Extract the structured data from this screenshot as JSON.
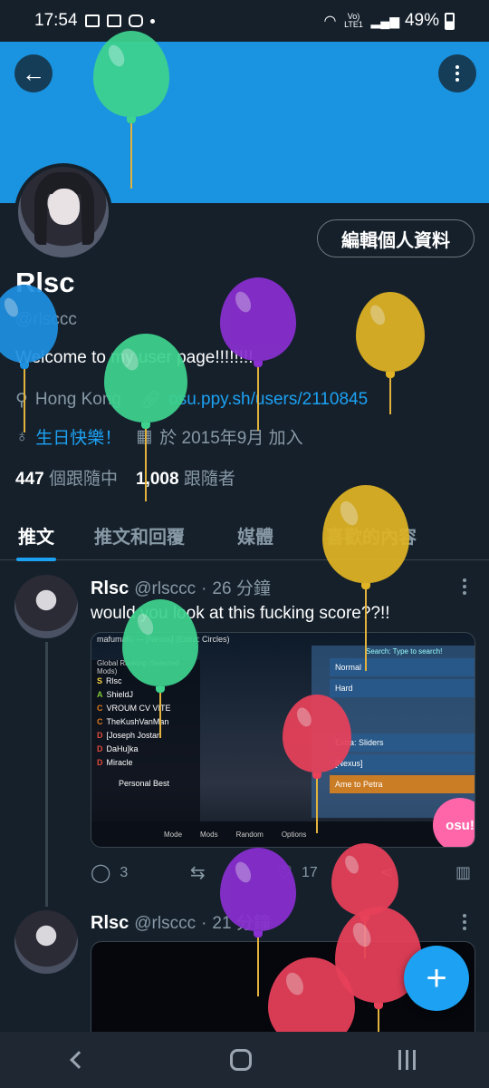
{
  "status_bar": {
    "time": "17:54",
    "battery": "49%",
    "network": "Vo) LTE1"
  },
  "profile": {
    "name": "Rlsc",
    "handle": "@rlsccc",
    "bio": "Welcome to my user page!!!!!!!!",
    "location": "Hong Kong",
    "website": "osu.ppy.sh/users/2110845",
    "birthday": "生日快樂！",
    "joined": "於 2015年9月 加入",
    "following_count": "447",
    "following_label": "個跟隨中",
    "followers_count": "1,008",
    "followers_label": "跟隨者",
    "edit_label": "編輯個人資料"
  },
  "tabs": [
    {
      "label": "推文"
    },
    {
      "label": "推文和回覆"
    },
    {
      "label": "媒體"
    },
    {
      "label": "喜歡的內容"
    }
  ],
  "tweets": [
    {
      "name": "Rlsc",
      "handle": "@rlsccc",
      "sep": "·",
      "time": "26 分鐘",
      "text": "would you look at this fucking score??!!",
      "replies": "3",
      "retweets": "",
      "likes": "17",
      "media_text": {
        "header": "mafumafu — [Nexus] (Extra: Circles)",
        "ranking": "Global Ranking (Selected Mods)",
        "rows": [
          "Rlsc",
          "ShieldJ",
          "VROUM CV VITE",
          "TheKushVanMan",
          "[Joseph Jostar",
          "DaHu]ka",
          "Miracle"
        ],
        "personal_best": "Personal Best",
        "search": "Search: Type to search!",
        "right_rows": [
          "Normal",
          "Hard",
          "Extra: Sliders",
          "[Nexus]",
          "Ame to Petra"
        ],
        "bottom": [
          "Mode",
          "Mods",
          "Random",
          "Options"
        ],
        "logo": "osu!"
      }
    },
    {
      "name": "Rlsc",
      "handle": "@rlsccc",
      "sep": "·",
      "time": "21 分鐘"
    }
  ],
  "fab_label": "+",
  "balloon_colors": {
    "green": "#3ed38f",
    "blue": "#1f8fe0",
    "purple": "#8a2fd1",
    "yellow": "#e0b424",
    "red": "#e8415a"
  }
}
